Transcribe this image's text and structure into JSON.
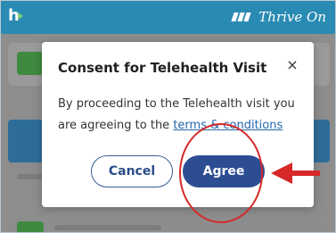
{
  "app_bar": {
    "logo_text": "h",
    "brand_text": "Thrive On"
  },
  "modal": {
    "title": "Consent for Telehealth Visit",
    "close_label": "×",
    "body_text": "By proceeding to the Telehealth visit you are agreeing to the ",
    "terms_link": "terms & conditions",
    "cancel_label": "Cancel",
    "agree_label": "Agree"
  },
  "annotations": {
    "highlight_color": "#d62828"
  },
  "icons": {
    "logo_play_icon": "play-triangle",
    "brand_bars_icon": "three-slanted-bars",
    "close_icon": "x"
  }
}
